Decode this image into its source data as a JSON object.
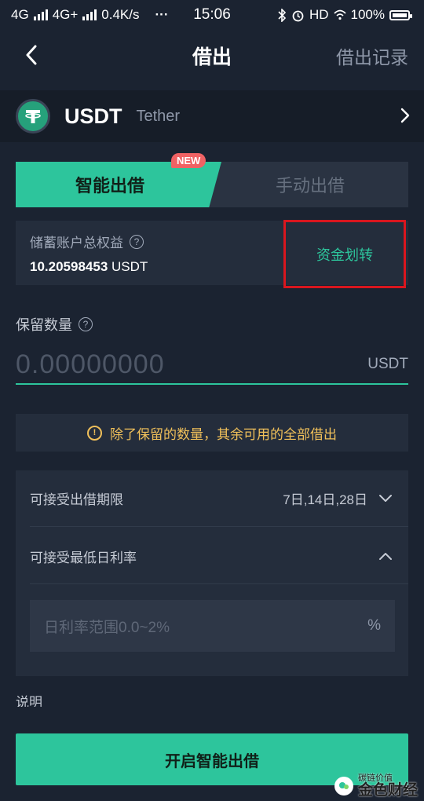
{
  "status_bar": {
    "network1": "4G",
    "network2": "4G+",
    "speed": "0.4K/s",
    "dots": "···",
    "time": "15:06",
    "hd": "HD",
    "battery": "100%"
  },
  "nav": {
    "title": "借出",
    "right_link": "借出记录"
  },
  "coin": {
    "symbol": "USDT",
    "name": "Tether",
    "brand_color": "#26a17b"
  },
  "tabs": {
    "active": "智能出借",
    "inactive": "手动出借",
    "badge": "NEW"
  },
  "equity": {
    "label": "储蓄账户总权益",
    "value": "10.20598453",
    "unit": "USDT",
    "transfer_label": "资金划转"
  },
  "reserve": {
    "label": "保留数量",
    "placeholder": "0.00000000",
    "unit": "USDT"
  },
  "notice": {
    "text": "除了保留的数量，其余可用的全部借出"
  },
  "options": {
    "period_label": "可接受出借期限",
    "period_value": "7日,14日,28日",
    "rate_label": "可接受最低日利率",
    "rate_placeholder": "日利率范围0.0~2%",
    "rate_unit": "%"
  },
  "section_note": "说明",
  "submit_label": "开启智能出借",
  "watermark": {
    "small": "碳链价值",
    "big": "金色财经"
  },
  "colors": {
    "accent": "#2dc59c",
    "background": "#1b2331",
    "warning": "#f0c05a",
    "highlight_border": "#d9161e"
  }
}
